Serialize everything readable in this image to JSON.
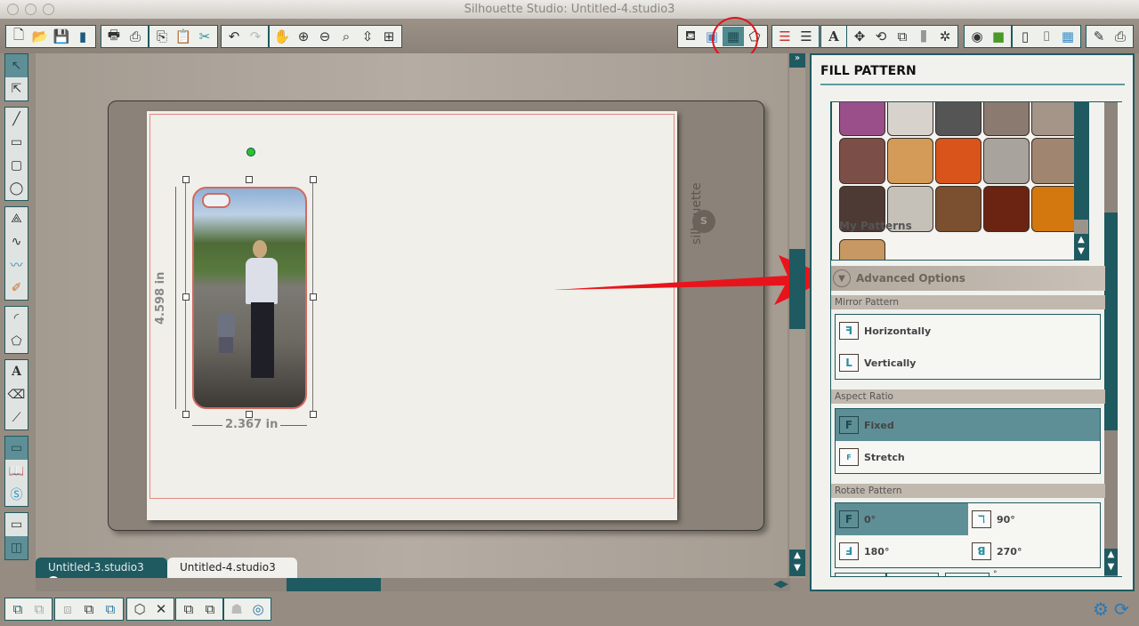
{
  "window": {
    "title": "Silhouette Studio: Untitled-4.studio3"
  },
  "toolbar": {
    "left": [
      "new-doc",
      "open",
      "save",
      "save-sd",
      "print",
      "send-to-cutter",
      "copy",
      "paste",
      "cut",
      "undo",
      "redo",
      "pan",
      "zoom-in",
      "zoom-out",
      "zoom-select",
      "zoom-fit",
      "fit-page"
    ],
    "right": [
      "fill-color",
      "gradient",
      "fill-pattern",
      "line-color",
      "line-style",
      "line-width",
      "text-style",
      "replicate",
      "transform",
      "scale",
      "align",
      "offset",
      "point-modify",
      "trace",
      "page-setup",
      "registration-marks",
      "grid",
      "cut-settings",
      "send"
    ],
    "selected": "fill-pattern"
  },
  "left_tools": [
    "select",
    "point-edit",
    "line",
    "rectangle",
    "rounded-rectangle",
    "ellipse",
    "polygon",
    "curve",
    "freehand",
    "smooth-freehand",
    "arc",
    "regular-polygon",
    "text",
    "eraser",
    "knife",
    "library",
    "design-store",
    "online-store",
    "show-design",
    "show-split"
  ],
  "canvas": {
    "brand": "silhouette",
    "logo": "S",
    "height_label": "4.598 in",
    "width_label": "2.367 in"
  },
  "tabs": [
    {
      "label": "Untitled-3.studio3",
      "close": "x",
      "active": false
    },
    {
      "label": "Untitled-4.studio3",
      "close": "x",
      "active": true
    }
  ],
  "panel": {
    "title": "FILL PATTERN",
    "swatch_colors": [
      "#9a4f8a",
      "#d8d2cc",
      "#555",
      "#8a7a70",
      "#a59488",
      "#7b4f47",
      "#d49a58",
      "#d9541a",
      "#a8a39c",
      "#a08570",
      "#4d3a35",
      "#c5c1b9",
      "#7a5030",
      "#6b2411",
      "#d2780e"
    ],
    "my_patterns_label": "My Patterns",
    "my_pattern_colors": [
      "#c79862"
    ],
    "advanced_label": "Advanced Options",
    "mirror": {
      "label": "Mirror Pattern",
      "options": [
        "Horizontally",
        "Vertically"
      ]
    },
    "aspect": {
      "label": "Aspect Ratio",
      "options": [
        "Fixed",
        "Stretch"
      ],
      "selected": "Fixed"
    },
    "rotate": {
      "label": "Rotate Pattern",
      "options": [
        "0°",
        "90°",
        "180°",
        "270°"
      ],
      "selected": "0°"
    },
    "degree_unit": "°"
  },
  "bottom_toolbar": [
    "group",
    "ungroup",
    "make-compound",
    "release-compound",
    "compound-path",
    "weld",
    "subtract",
    "bring-forward",
    "send-backward",
    "modify",
    "offset"
  ],
  "colors": {
    "accent": "#1e5a60",
    "selected": "#5f8f96",
    "annotation": "#e8141b"
  }
}
